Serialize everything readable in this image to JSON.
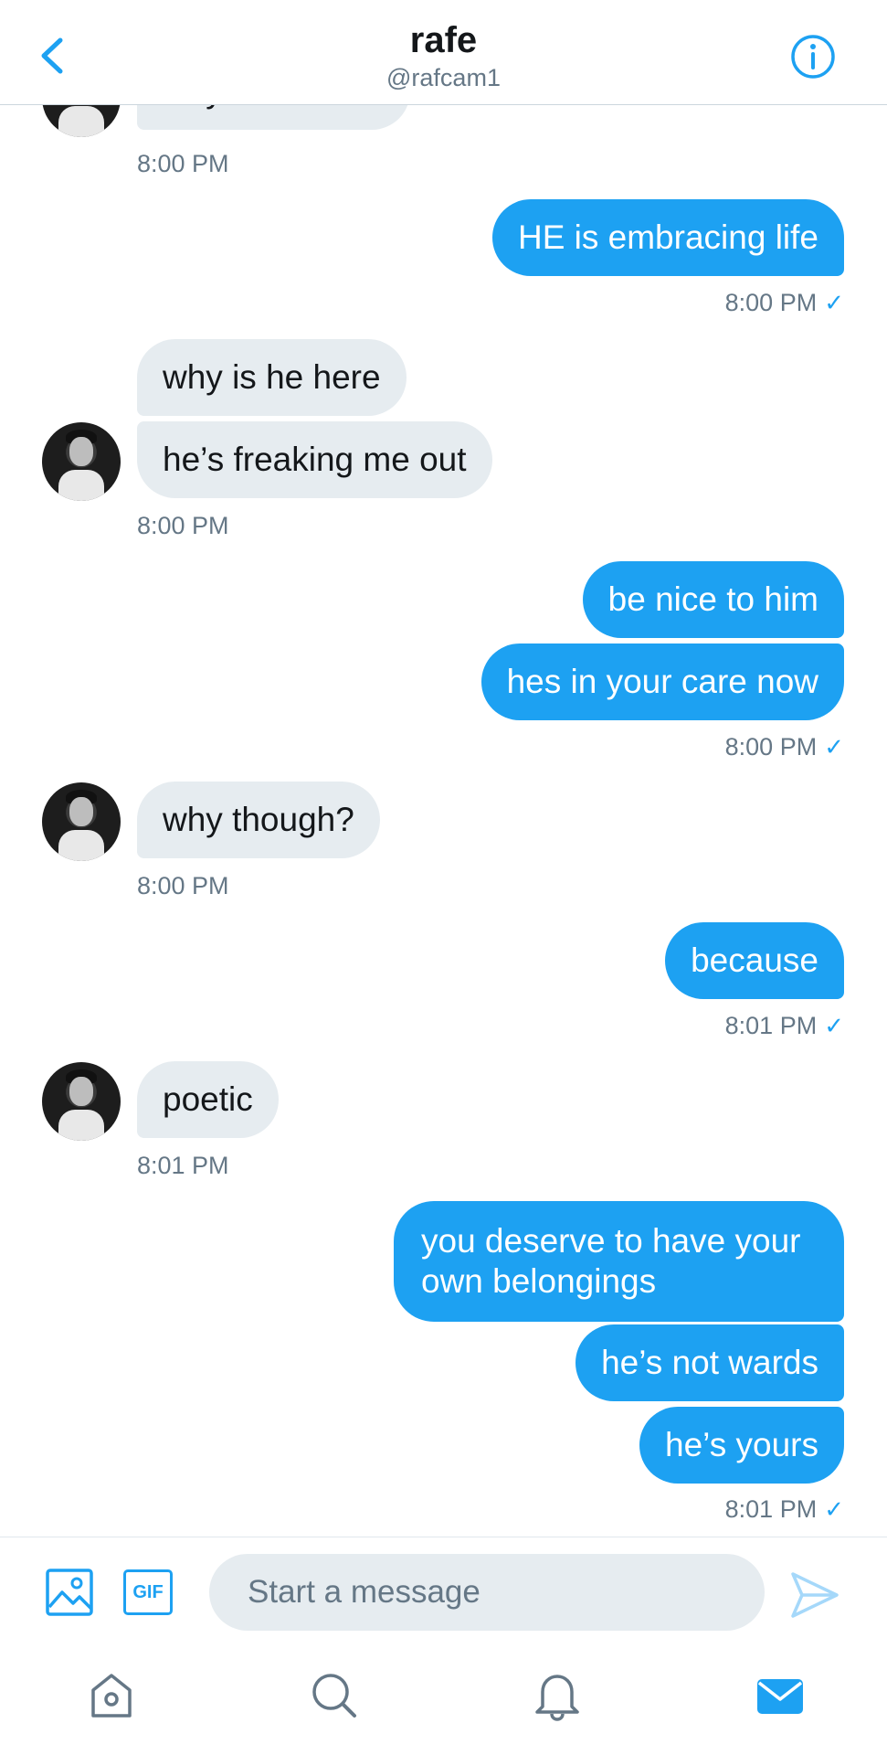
{
  "header": {
    "title": "rafe",
    "handle": "@rafcam1",
    "back_icon": "chevron-left-icon",
    "info_icon": "info-icon"
  },
  "messages": {
    "partial_text": "why is it naked",
    "ts1": "8:00 PM",
    "m_embracing": "HE is embracing life",
    "ts2": "8:00 PM",
    "m_why_here": "why is he here",
    "m_freaking": "he’s freaking me out",
    "ts3": "8:00 PM",
    "m_be_nice": "be nice to him",
    "m_care": "hes in your care now",
    "ts4": "8:00 PM",
    "m_why_though": "why though?",
    "ts5": "8:00 PM",
    "m_because": "because",
    "ts6": "8:01 PM",
    "m_poetic": "poetic",
    "ts7": "8:01 PM",
    "m_deserve": "you deserve to have your own belongings",
    "m_not_wards": "he’s not wards",
    "m_yours": "he’s yours",
    "ts8": "8:01 PM",
    "check": "✓"
  },
  "composer": {
    "placeholder": "Start a message",
    "gif_label": "GIF",
    "media_icon": "image-icon",
    "send_icon": "send-icon"
  },
  "tabbar": {
    "items": [
      "home-icon",
      "search-icon",
      "notifications-icon",
      "messages-icon"
    ]
  },
  "colors": {
    "accent": "#1da1f2",
    "incoming_bubble": "#e6ecf0",
    "meta_text": "#657786",
    "primary_text": "#14171a"
  }
}
